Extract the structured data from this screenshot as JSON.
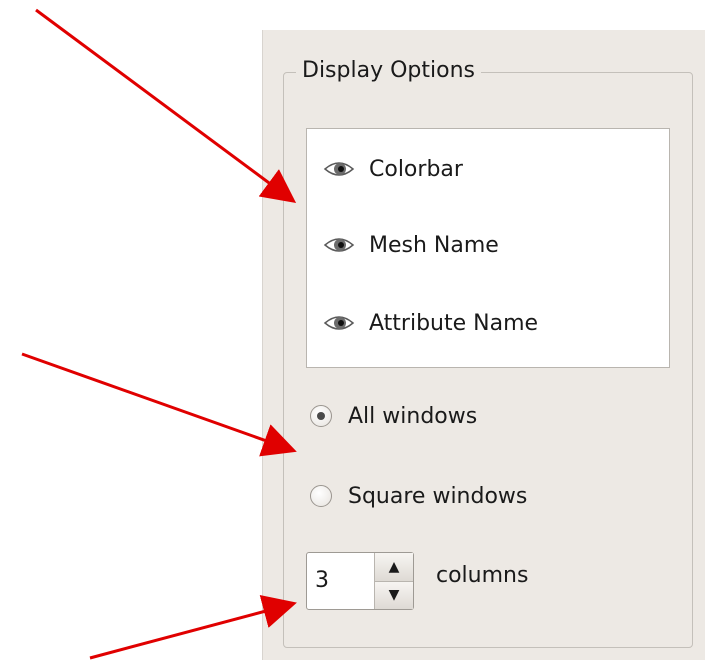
{
  "display_options": {
    "title": "Display Options",
    "list_items": [
      {
        "label": "Colorbar",
        "icon": "eye-icon"
      },
      {
        "label": "Mesh Name",
        "icon": "eye-icon"
      },
      {
        "label": "Attribute Name",
        "icon": "eye-icon"
      }
    ],
    "radios": [
      {
        "label": "All windows",
        "checked": true
      },
      {
        "label": "Square windows",
        "checked": false
      }
    ],
    "columns": {
      "value": "3",
      "label": "columns",
      "up_symbol": "▲",
      "down_symbol": "▼"
    }
  },
  "annotation_color": "#e00000",
  "panel_bg": "#ede9e4"
}
